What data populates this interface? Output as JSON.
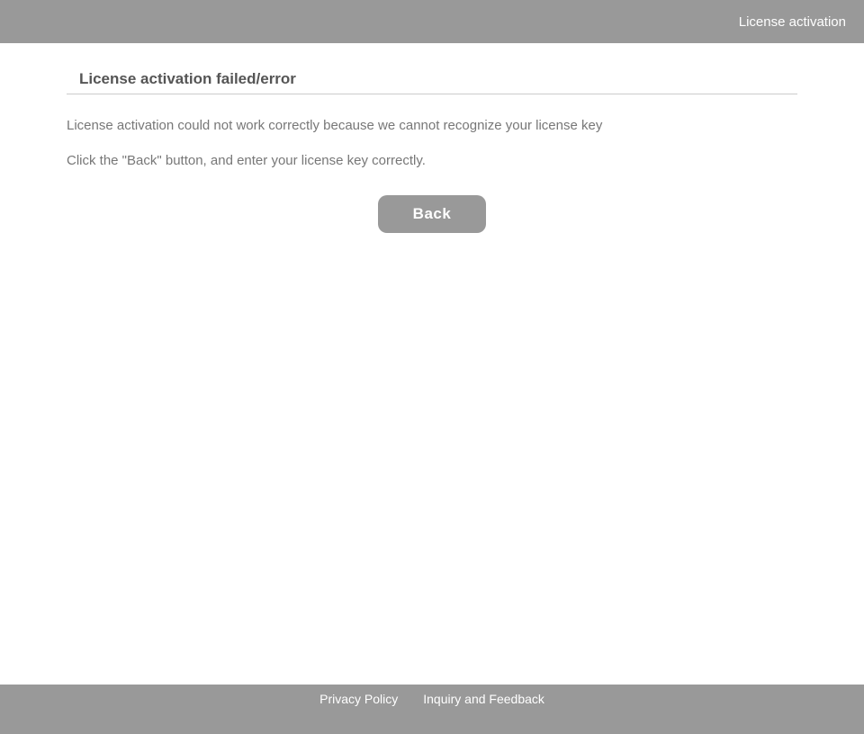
{
  "header": {
    "title": "License activation"
  },
  "main": {
    "page_title": "License activation failed/error",
    "message_line1": "License activation could not work correctly because we cannot recognize your license key",
    "message_line2": "Click the \"Back\" button, and enter your license key correctly.",
    "back_button_label": "Back"
  },
  "footer": {
    "privacy_label": "Privacy Policy",
    "inquiry_label": "Inquiry and Feedback"
  }
}
